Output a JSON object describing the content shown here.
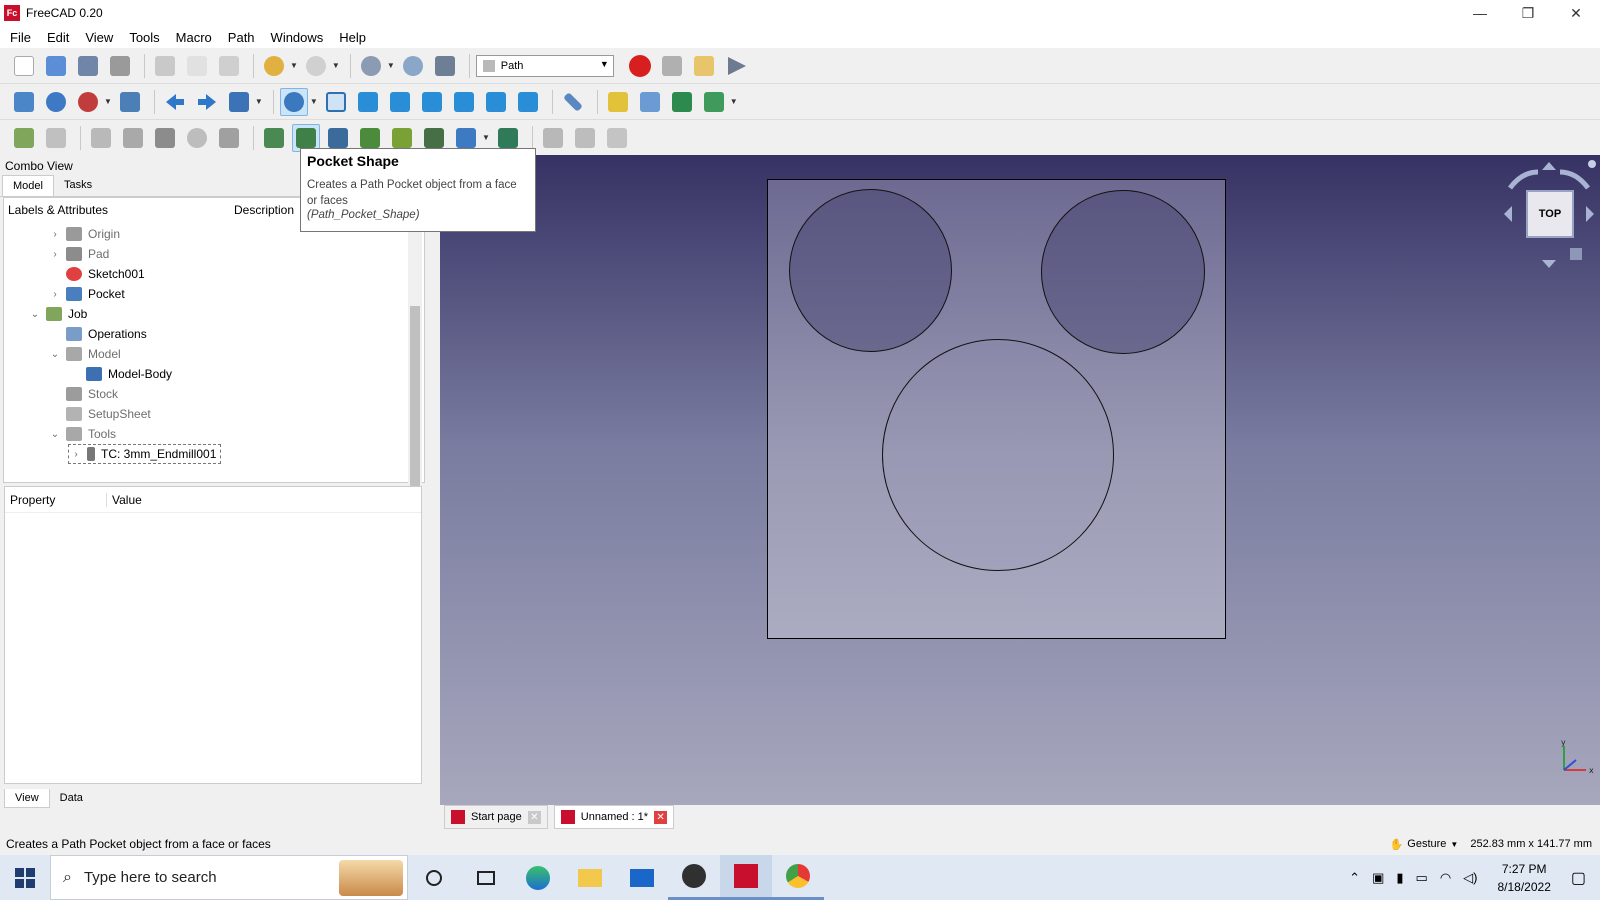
{
  "window": {
    "title": "FreeCAD 0.20",
    "app_icon": "Fc",
    "minimize": "—",
    "maximize": "❐",
    "close": "✕"
  },
  "menu": [
    "File",
    "Edit",
    "View",
    "Tools",
    "Macro",
    "Path",
    "Windows",
    "Help"
  ],
  "workbench": {
    "selected": "Path"
  },
  "combo_view": {
    "title": "Combo View",
    "tabs": [
      "Model",
      "Tasks"
    ],
    "columns": [
      "Labels & Attributes",
      "Description"
    ],
    "tree": [
      {
        "label": "Origin",
        "icon": "origin-icon",
        "expander": "›",
        "dim": true
      },
      {
        "label": "Pad",
        "icon": "pad-icon",
        "expander": "›",
        "dim": true
      },
      {
        "label": "Sketch001",
        "icon": "sketch-icon",
        "expander": "",
        "dim": false
      },
      {
        "label": "Pocket",
        "icon": "pocket-icon",
        "expander": "›",
        "dim": false
      },
      {
        "label": "Job",
        "icon": "job-icon",
        "expander": "⌄",
        "dim": false
      },
      {
        "label": "Operations",
        "icon": "folder-icon",
        "expander": "",
        "dim": false
      },
      {
        "label": "Model",
        "icon": "folder-icon",
        "expander": "⌄",
        "dim": true
      },
      {
        "label": "Model-Body",
        "icon": "body-icon",
        "expander": "",
        "dim": false
      },
      {
        "label": "Stock",
        "icon": "stock-icon",
        "expander": "",
        "dim": true
      },
      {
        "label": "SetupSheet",
        "icon": "setupsheet-icon",
        "expander": "",
        "dim": true
      },
      {
        "label": "Tools",
        "icon": "folder-icon",
        "expander": "⌄",
        "dim": true
      },
      {
        "label": "TC: 3mm_Endmill001",
        "icon": "toolcontroller-icon",
        "expander": "›",
        "dim": false
      }
    ],
    "property_columns": [
      "Property",
      "Value"
    ],
    "bottom_tabs": [
      "View",
      "Data"
    ]
  },
  "tooltip": {
    "title": "Pocket Shape",
    "description": "Creates a Path Pocket object from a face or faces",
    "command": "(Path_Pocket_Shape)"
  },
  "navcube": {
    "face": "TOP"
  },
  "doc_tabs": [
    {
      "label": "Start page",
      "active": false
    },
    {
      "label": "Unnamed : 1*",
      "active": true
    }
  ],
  "status": {
    "message": "Creates a Path Pocket object from a face or faces",
    "nav_style": "Gesture",
    "dimensions": "252.83 mm x 141.77 mm"
  },
  "taskbar": {
    "search_placeholder": "Type here to search",
    "time": "7:27 PM",
    "date": "8/18/2022"
  },
  "colors": {
    "accent": "#cce4f7",
    "record": "#d81f1f",
    "viewport_top": "#363264",
    "viewport_bottom": "#a7a7bd"
  }
}
